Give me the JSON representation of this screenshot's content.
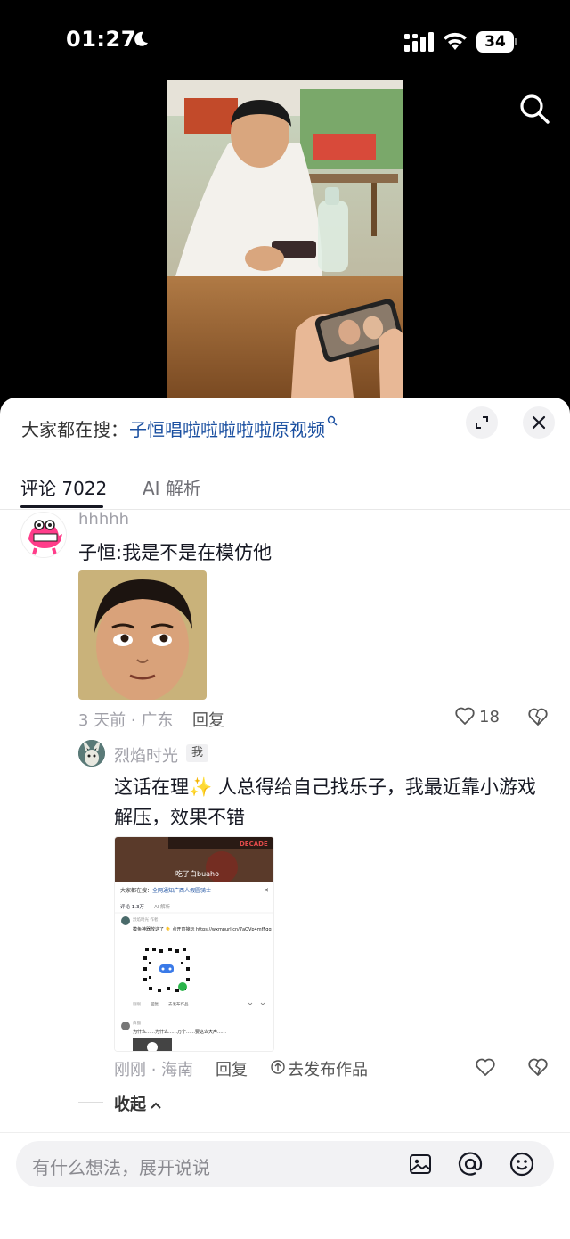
{
  "status_bar": {
    "time": "01:27",
    "battery": "34"
  },
  "search_bar": {
    "prefix": "大家都在搜：",
    "query": "子恒唱啦啦啦啦啦原视频"
  },
  "tabs": [
    {
      "label": "评论 7022",
      "active": true
    },
    {
      "label": "AI 解析",
      "active": false
    }
  ],
  "comments": [
    {
      "username": "hhhhh",
      "text": "子恒:我是不是在模仿他",
      "meta": "3 天前 · 广东",
      "reply_label": "回复",
      "likes": "18"
    }
  ],
  "reply": {
    "username": "烈焰时光",
    "badge": "我",
    "text_before": "这话在理",
    "emoji": "✨",
    "text_after": " 人总得给自己找乐子，我最近靠小游戏解压，效果不错",
    "meta": "刚刚 · 海南",
    "reply_label": "回复",
    "publish_label": "去发布作品",
    "embedded": {
      "video_caption": "吃了白buaho",
      "video_banner": "DECADE",
      "search_prefix": "大家都在搜：",
      "search_query": "全网通知广西人假圆骑士",
      "tab_comments": "评论 1.3万",
      "tab_ai": "AI 解析",
      "commenter": "烈焰时光 作者",
      "comment_text": "摸鱼神器放这了 👇 点开直接玩 https://wxmpurl.cn/7aQVp4mfFqq",
      "meta": "刚刚",
      "reply": "回复",
      "publish": "去发布作品",
      "commenter2": "白猫",
      "comment2": "为什么……为什么……万宁……要这么大声……"
    }
  },
  "collapse_label": "收起",
  "input": {
    "placeholder": "有什么想法，展开说说"
  }
}
